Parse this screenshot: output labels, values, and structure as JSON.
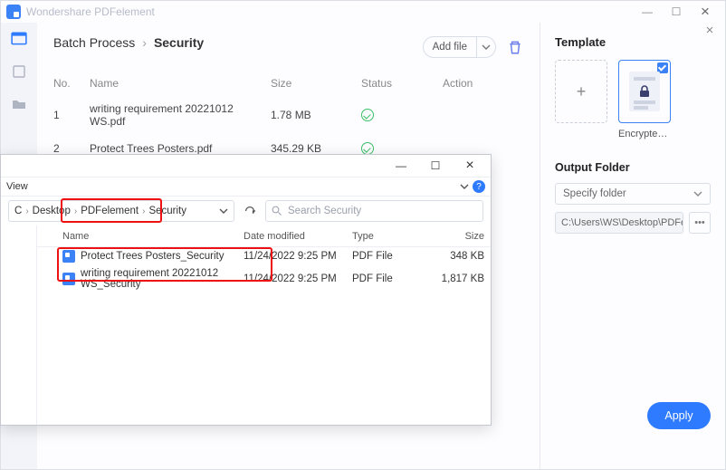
{
  "titlebar": {
    "app_name": "Wondershare PDFelement"
  },
  "batch": {
    "crumb_root": "Batch Process",
    "crumb_current": "Security",
    "add_file_label": "Add file",
    "columns": {
      "no": "No.",
      "name": "Name",
      "size": "Size",
      "status": "Status",
      "action": "Action"
    },
    "rows": [
      {
        "no": "1",
        "name": "writing requirement 20221012 WS.pdf",
        "size": "1.78 MB"
      },
      {
        "no": "2",
        "name": "Protect Trees Posters.pdf",
        "size": "345.29 KB"
      }
    ]
  },
  "template": {
    "heading": "Template",
    "encrypted_label": "Encrypted ..."
  },
  "output_folder": {
    "heading": "Output Folder",
    "dropdown_label": "Specify folder",
    "path": "C:\\Users\\WS\\Desktop\\PDFelement\\Sec"
  },
  "apply_label": "Apply",
  "explorer": {
    "view_label": "View",
    "path_segments": {
      "root": "C",
      "desktop": "Desktop",
      "p1": "PDFelement",
      "p2": "Security"
    },
    "search_placeholder": "Search Security",
    "columns": {
      "name": "Name",
      "date": "Date modified",
      "type": "Type",
      "size": "Size"
    },
    "rows": [
      {
        "name": "Protect Trees Posters_Security",
        "date": "11/24/2022 9:25 PM",
        "type": "PDF File",
        "size": "348 KB"
      },
      {
        "name": "writing requirement 20221012 WS_Security",
        "date": "11/24/2022 9:25 PM",
        "type": "PDF File",
        "size": "1,817 KB"
      }
    ]
  }
}
